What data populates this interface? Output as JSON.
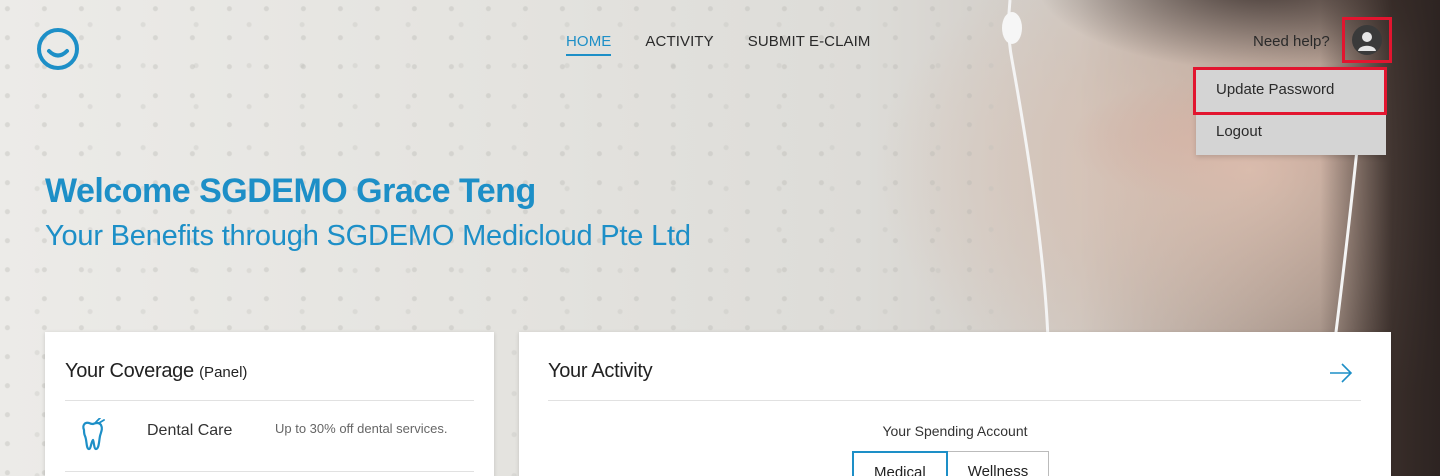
{
  "header": {
    "logo_icon": "smile-circle-logo",
    "nav": [
      {
        "label": "HOME",
        "active": true
      },
      {
        "label": "ACTIVITY",
        "active": false
      },
      {
        "label": "SUBMIT E-CLAIM",
        "active": false
      }
    ],
    "help_text": "Need help?",
    "user_icon": "user-avatar-icon"
  },
  "user_menu": {
    "items": [
      {
        "label": "Update Password"
      },
      {
        "label": "Logout"
      }
    ]
  },
  "hero": {
    "welcome": "Welcome SGDEMO Grace Teng",
    "subtitle": "Your Benefits through SGDEMO Medicloud Pte Ltd"
  },
  "coverage": {
    "title": "Your Coverage",
    "qualifier": "(Panel)",
    "items": [
      {
        "icon": "tooth-icon",
        "name": "Dental Care",
        "description": "Up to 30% off dental services."
      }
    ]
  },
  "activity": {
    "title": "Your Activity",
    "arrow_icon": "arrow-right-icon",
    "spending_label": "Your Spending Account",
    "tabs": [
      {
        "label": "Medical",
        "active": true
      },
      {
        "label": "Wellness",
        "active": false
      }
    ]
  },
  "colors": {
    "accent": "#1d8fc7",
    "highlight": "#e2152f",
    "menu_bg": "#d4d4d4"
  }
}
